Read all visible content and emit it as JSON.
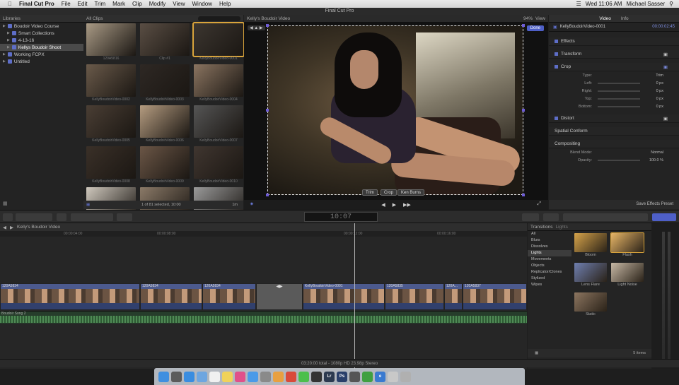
{
  "menubar": {
    "app": "Final Cut Pro",
    "items": [
      "File",
      "Edit",
      "Trim",
      "Mark",
      "Clip",
      "Modify",
      "View",
      "Window",
      "Help"
    ],
    "clock": "Wed 11:06 AM",
    "user": "Michael Sasser"
  },
  "window_title": "Final Cut Pro",
  "libraries": {
    "header": "Libraries",
    "items": [
      {
        "label": "Boudoir Video Course",
        "level": 0,
        "selected": false
      },
      {
        "label": "Smart Collections",
        "level": 1,
        "selected": false
      },
      {
        "label": "4-13-16",
        "level": 1,
        "selected": false
      },
      {
        "label": "Kellys Boudoir Shoot",
        "level": 1,
        "selected": true
      },
      {
        "label": "Working FCPX",
        "level": 0,
        "selected": false
      },
      {
        "label": "Untitled",
        "level": 0,
        "selected": false
      }
    ]
  },
  "browser": {
    "filter": "All Clips",
    "status": "1 of 81 selected, 10:00",
    "duration": "1m",
    "clips": [
      {
        "name": "120A5816",
        "selected": false
      },
      {
        "name": "Clip #1",
        "selected": false
      },
      {
        "name": "KellyBoudoirVideo-0001",
        "selected": true
      },
      {
        "name": "KellyBoudoirVideo-0002",
        "selected": false
      },
      {
        "name": "KellyBoudoirVideo-0003",
        "selected": false
      },
      {
        "name": "KellyBoudoirVideo-0004",
        "selected": false
      },
      {
        "name": "KellyBoudoirVideo-0005",
        "selected": false
      },
      {
        "name": "KellyBoudoirVideo-0006",
        "selected": false
      },
      {
        "name": "KellyBoudoirVideo-0007",
        "selected": false
      },
      {
        "name": "KellyBoudoirVideo-0008",
        "selected": false
      },
      {
        "name": "KellyBoudoirVideo-0009",
        "selected": false
      },
      {
        "name": "KellyBoudoirVideo-0010",
        "selected": false
      },
      {
        "name": "",
        "selected": false
      },
      {
        "name": "",
        "selected": false
      },
      {
        "name": "",
        "selected": false
      }
    ]
  },
  "viewer": {
    "title": "Kelly's Boudoir Video",
    "zoom": "94%",
    "view_label": "View",
    "done_label": "Done",
    "crop_buttons": [
      "Trim",
      "Crop",
      "Ken Burns"
    ]
  },
  "inspector": {
    "tabs": [
      "Video",
      "Info"
    ],
    "clip_name": "KellyBoudoirVideo-0001",
    "clip_time": "00:00:02:45",
    "sections": {
      "effects": "Effects",
      "transform": "Transform",
      "crop": "Crop",
      "distort": "Distort",
      "spatial": "Spatial Conform",
      "compositing": "Compositing"
    },
    "crop_rows": [
      {
        "label": "Type:",
        "value": "Trim"
      },
      {
        "label": "Left:",
        "value": "0 px"
      },
      {
        "label": "Right:",
        "value": "0 px"
      },
      {
        "label": "Top:",
        "value": "0 px"
      },
      {
        "label": "Bottom:",
        "value": "0 px"
      }
    ],
    "comp_rows": [
      {
        "label": "Blend Mode:",
        "value": "Normal"
      },
      {
        "label": "Opacity:",
        "value": "100.0 %"
      }
    ],
    "save_preset": "Save Effects Preset"
  },
  "timecode": "10:07",
  "timeline": {
    "project": "Kelly's Boudoir Video",
    "ruler": [
      "00:00:04:00",
      "00:00:08:00",
      "00:00:12:00",
      "00:00:16:00"
    ],
    "clips": [
      {
        "name": "120A5834"
      },
      {
        "name": "120A5834"
      },
      {
        "name": "120A5834"
      },
      {
        "name": "KellyBoudoirVideo-0001"
      },
      {
        "name": "120A5835"
      },
      {
        "name": "120A..."
      },
      {
        "name": "120A5837"
      }
    ],
    "audio_name": "Boudoir Song 2",
    "status": "03:20:00 total - 1080p HD 23.98p Stereo"
  },
  "transitions": {
    "header": "Transitions",
    "filter": "Lights",
    "categories": [
      "All",
      "Blurs",
      "Dissolves",
      "Lights",
      "Movements",
      "Objects",
      "Replicator/Clones",
      "Stylized",
      "Wipes"
    ],
    "selected_category": "Lights",
    "items": [
      {
        "name": "Bloom",
        "color": "#d6a34a"
      },
      {
        "name": "Flash",
        "color": "#e7b566"
      },
      {
        "name": "Lens Flare",
        "color": "#6f7fb0"
      },
      {
        "name": "Light Noise",
        "color": "#c7b8a5"
      },
      {
        "name": "Static",
        "color": "#8c7560"
      }
    ],
    "count": "5 items"
  },
  "dock": [
    {
      "icon": "finder-icon",
      "color": "#3f8fe0",
      "label": ""
    },
    {
      "icon": "launchpad-icon",
      "color": "#5b5b5b",
      "label": ""
    },
    {
      "icon": "safari-icon",
      "color": "#3a8de0",
      "label": ""
    },
    {
      "icon": "mail-icon",
      "color": "#6ea6e0",
      "label": ""
    },
    {
      "icon": "calendar-icon",
      "color": "#f0f0f0",
      "label": ""
    },
    {
      "icon": "notes-icon",
      "color": "#f0d25a",
      "label": ""
    },
    {
      "icon": "itunes-icon",
      "color": "#e0508a",
      "label": ""
    },
    {
      "icon": "appstore-icon",
      "color": "#4a9ae8",
      "label": ""
    },
    {
      "icon": "system-prefs-icon",
      "color": "#8a8a8a",
      "label": ""
    },
    {
      "icon": "photos-icon",
      "color": "#e8a040",
      "label": ""
    },
    {
      "icon": "chrome-icon",
      "color": "#d94a3a",
      "label": ""
    },
    {
      "icon": "messages-icon",
      "color": "#4cbf4c",
      "label": ""
    },
    {
      "icon": "clapper-icon",
      "color": "#333",
      "label": ""
    },
    {
      "icon": "lightroom-icon",
      "color": "#2c3a50",
      "label": "Lr"
    },
    {
      "icon": "photoshop-icon",
      "color": "#2a3f6a",
      "label": "Ps"
    },
    {
      "icon": "finalcut-icon",
      "color": "#555",
      "label": ""
    },
    {
      "icon": "facetime-icon",
      "color": "#40a040",
      "label": ""
    },
    {
      "icon": "ie-icon",
      "color": "#3a7ad0",
      "label": "e"
    },
    {
      "icon": "preview-icon",
      "color": "#c8c8c8",
      "label": ""
    },
    {
      "icon": "trash-icon",
      "color": "#b0b0b0",
      "label": ""
    }
  ]
}
